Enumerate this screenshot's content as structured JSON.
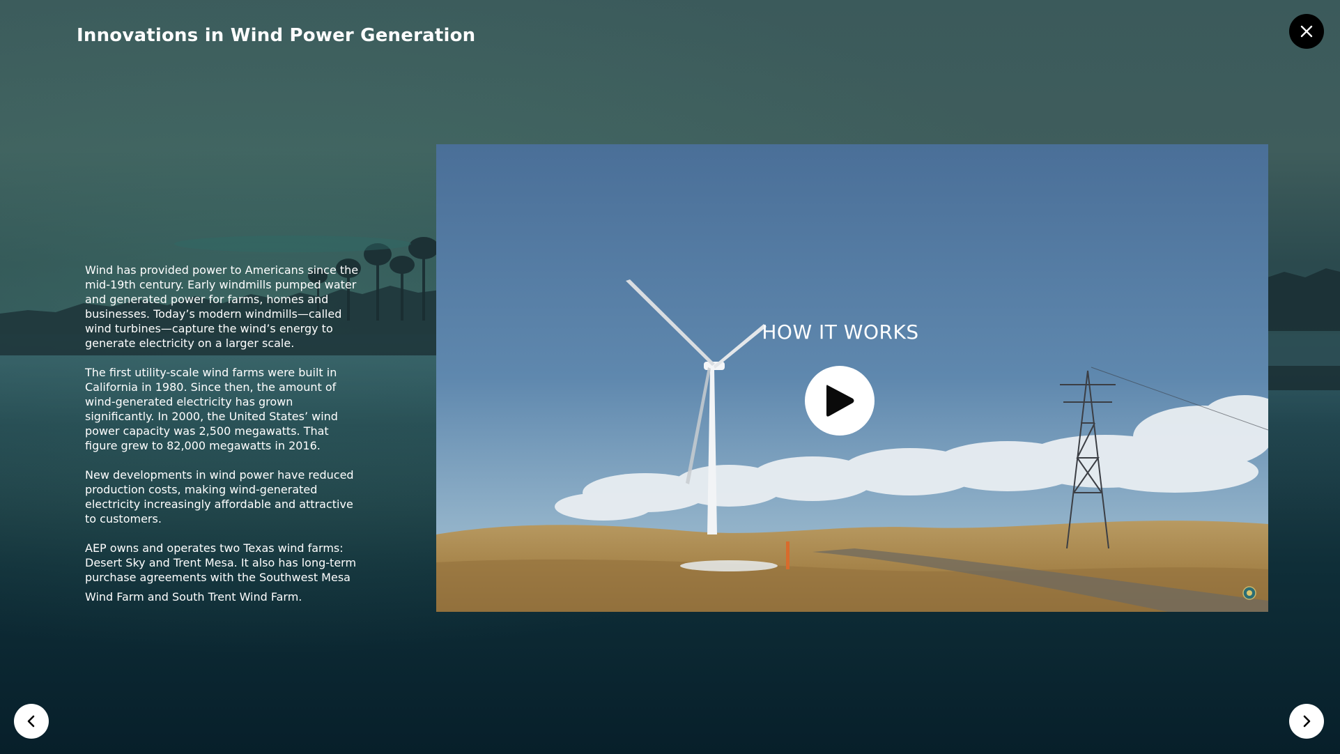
{
  "modal": {
    "title": "Innovations in Wind Power Generation",
    "close_icon": "close-icon"
  },
  "content": {
    "paragraphs": [
      "Wind has provided power to Americans since the mid-19th century. Early windmills pumped water and generated power for farms, homes and businesses. Today’s modern windmills—called wind turbines—capture the wind’s energy to generate electricity on a larger scale.",
      "The first utility-scale wind farms were built in California in 1980. Since then, the amount of wind-generated electricity has grown significantly. In 2000, the United States’ wind power capacity was 2,500 megawatts. That figure grew to 82,000 megawatts in 2016.",
      "New developments in wind power have reduced production costs, making wind-generated electricity increasingly affordable and attractive to customers.",
      "AEP owns and operates two Texas wind farms: Desert Sky and Trent Mesa. It also has long-term purchase agreements with the Southwest Mesa",
      "Wind Farm and South Trent Wind Farm."
    ]
  },
  "video": {
    "label": "HOW IT WORKS",
    "play_icon": "play-icon",
    "thumbnail": "wind-turbine-thumbnail"
  },
  "navigation": {
    "prev_icon": "chevron-left-icon",
    "next_icon": "chevron-right-icon"
  },
  "colors": {
    "overlay_text": "#ffffff",
    "close_button": "#000000",
    "nav_button": "#ffffff"
  }
}
